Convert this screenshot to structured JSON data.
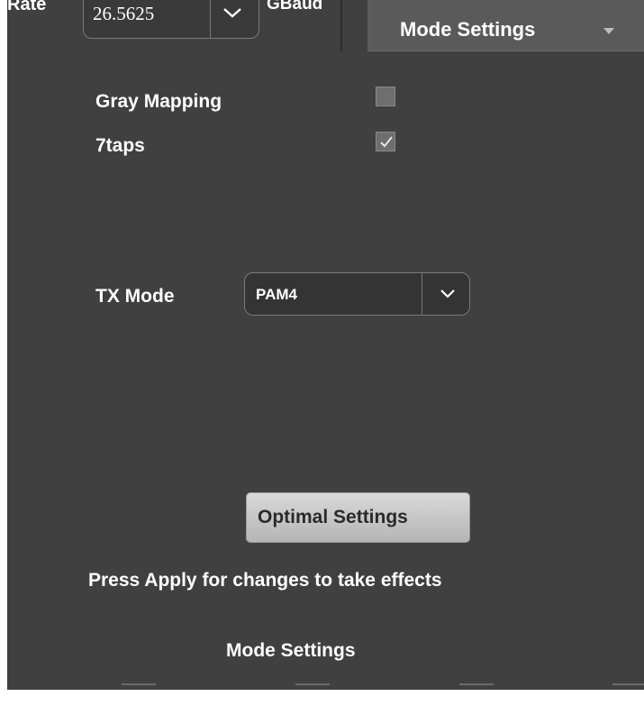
{
  "top_bar": {
    "rate_label": "Rate",
    "rate_value": "26.5625",
    "rate_unit": "GBaud"
  },
  "tab": {
    "label": "Mode Settings"
  },
  "options": [
    {
      "label": "Gray Mapping",
      "checked": false
    },
    {
      "label": "7taps",
      "checked": true
    }
  ],
  "tx_mode": {
    "label": "TX Mode",
    "value": "PAM4"
  },
  "optimal_button": {
    "label": "Optimal Settings"
  },
  "hint_text": "Press Apply for changes to take effects",
  "footer_title": "Mode Settings",
  "colors": {
    "panel_bg": "#404040",
    "tab_bg": "#5a5a5a",
    "button_bg": "#cfcfcf",
    "text": "#ffffff"
  }
}
